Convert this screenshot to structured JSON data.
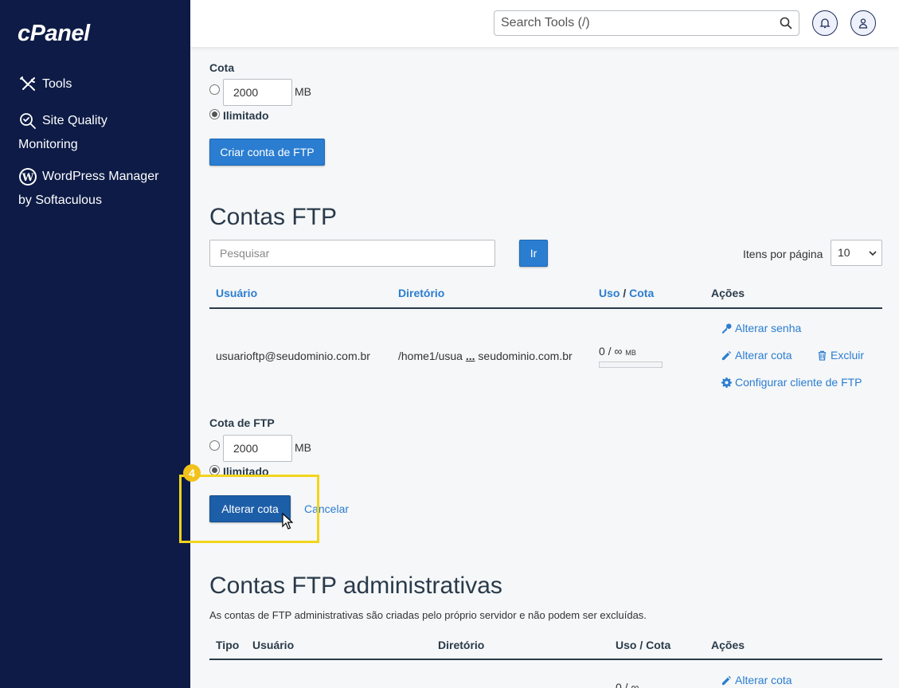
{
  "sidebar": {
    "logo": "cPanel",
    "items": [
      {
        "label_line1": "Tools",
        "label_line2": ""
      },
      {
        "label_line1": "Site Quality",
        "label_line2": "Monitoring"
      },
      {
        "label_line1": "WordPress Manager",
        "label_line2": "by Softaculous"
      }
    ]
  },
  "header": {
    "search_placeholder": "Search Tools (/)"
  },
  "create_form": {
    "quota_label": "Cota",
    "quota_value": "2000",
    "quota_unit": "MB",
    "unlimited_label": "Ilimitado",
    "create_button": "Criar conta de FTP"
  },
  "ftp_accounts": {
    "title": "Contas FTP",
    "search_placeholder": "Pesquisar",
    "go_button": "Ir",
    "per_page_label": "Itens por página",
    "per_page_value": "10",
    "columns": {
      "user": "Usuário",
      "directory": "Diretório",
      "usage": "Uso",
      "slash": "/",
      "quota": "Cota",
      "actions": "Ações"
    },
    "row": {
      "user": "usuarioftp@seudominio.com.br",
      "directory_start": "/home1/usua",
      "directory_ellipsis": "...",
      "directory_end": "seudominio.com.br",
      "usage": "0 / ∞",
      "usage_unit": "MB",
      "usage_fraction": 0,
      "change_password": "Alterar senha",
      "change_quota": "Alterar cota",
      "delete": "Excluir",
      "configure_client": "Configurar cliente de FTP"
    },
    "edit_quota": {
      "label": "Cota de FTP",
      "value": "2000",
      "unit": "MB",
      "unlimited_label": "Ilimitado",
      "submit_button": "Alterar cota",
      "cancel_link": "Cancelar",
      "step_badge": "4"
    }
  },
  "admin_accounts": {
    "title": "Contas FTP administrativas",
    "description": "As contas de FTP administrativas são criadas pelo próprio servidor e não podem ser excluídas.",
    "columns": {
      "type": "Tipo",
      "user": "Usuário",
      "directory": "Diretório",
      "usage_quota": "Uso / Cota",
      "actions": "Ações"
    },
    "row": {
      "usage_partial": "0 / ∞",
      "change_quota": "Alterar cota"
    }
  },
  "colors": {
    "sidebar_bg": "#0d1b46",
    "accent": "#2a7dd1",
    "highlight": "#f1d51c"
  }
}
